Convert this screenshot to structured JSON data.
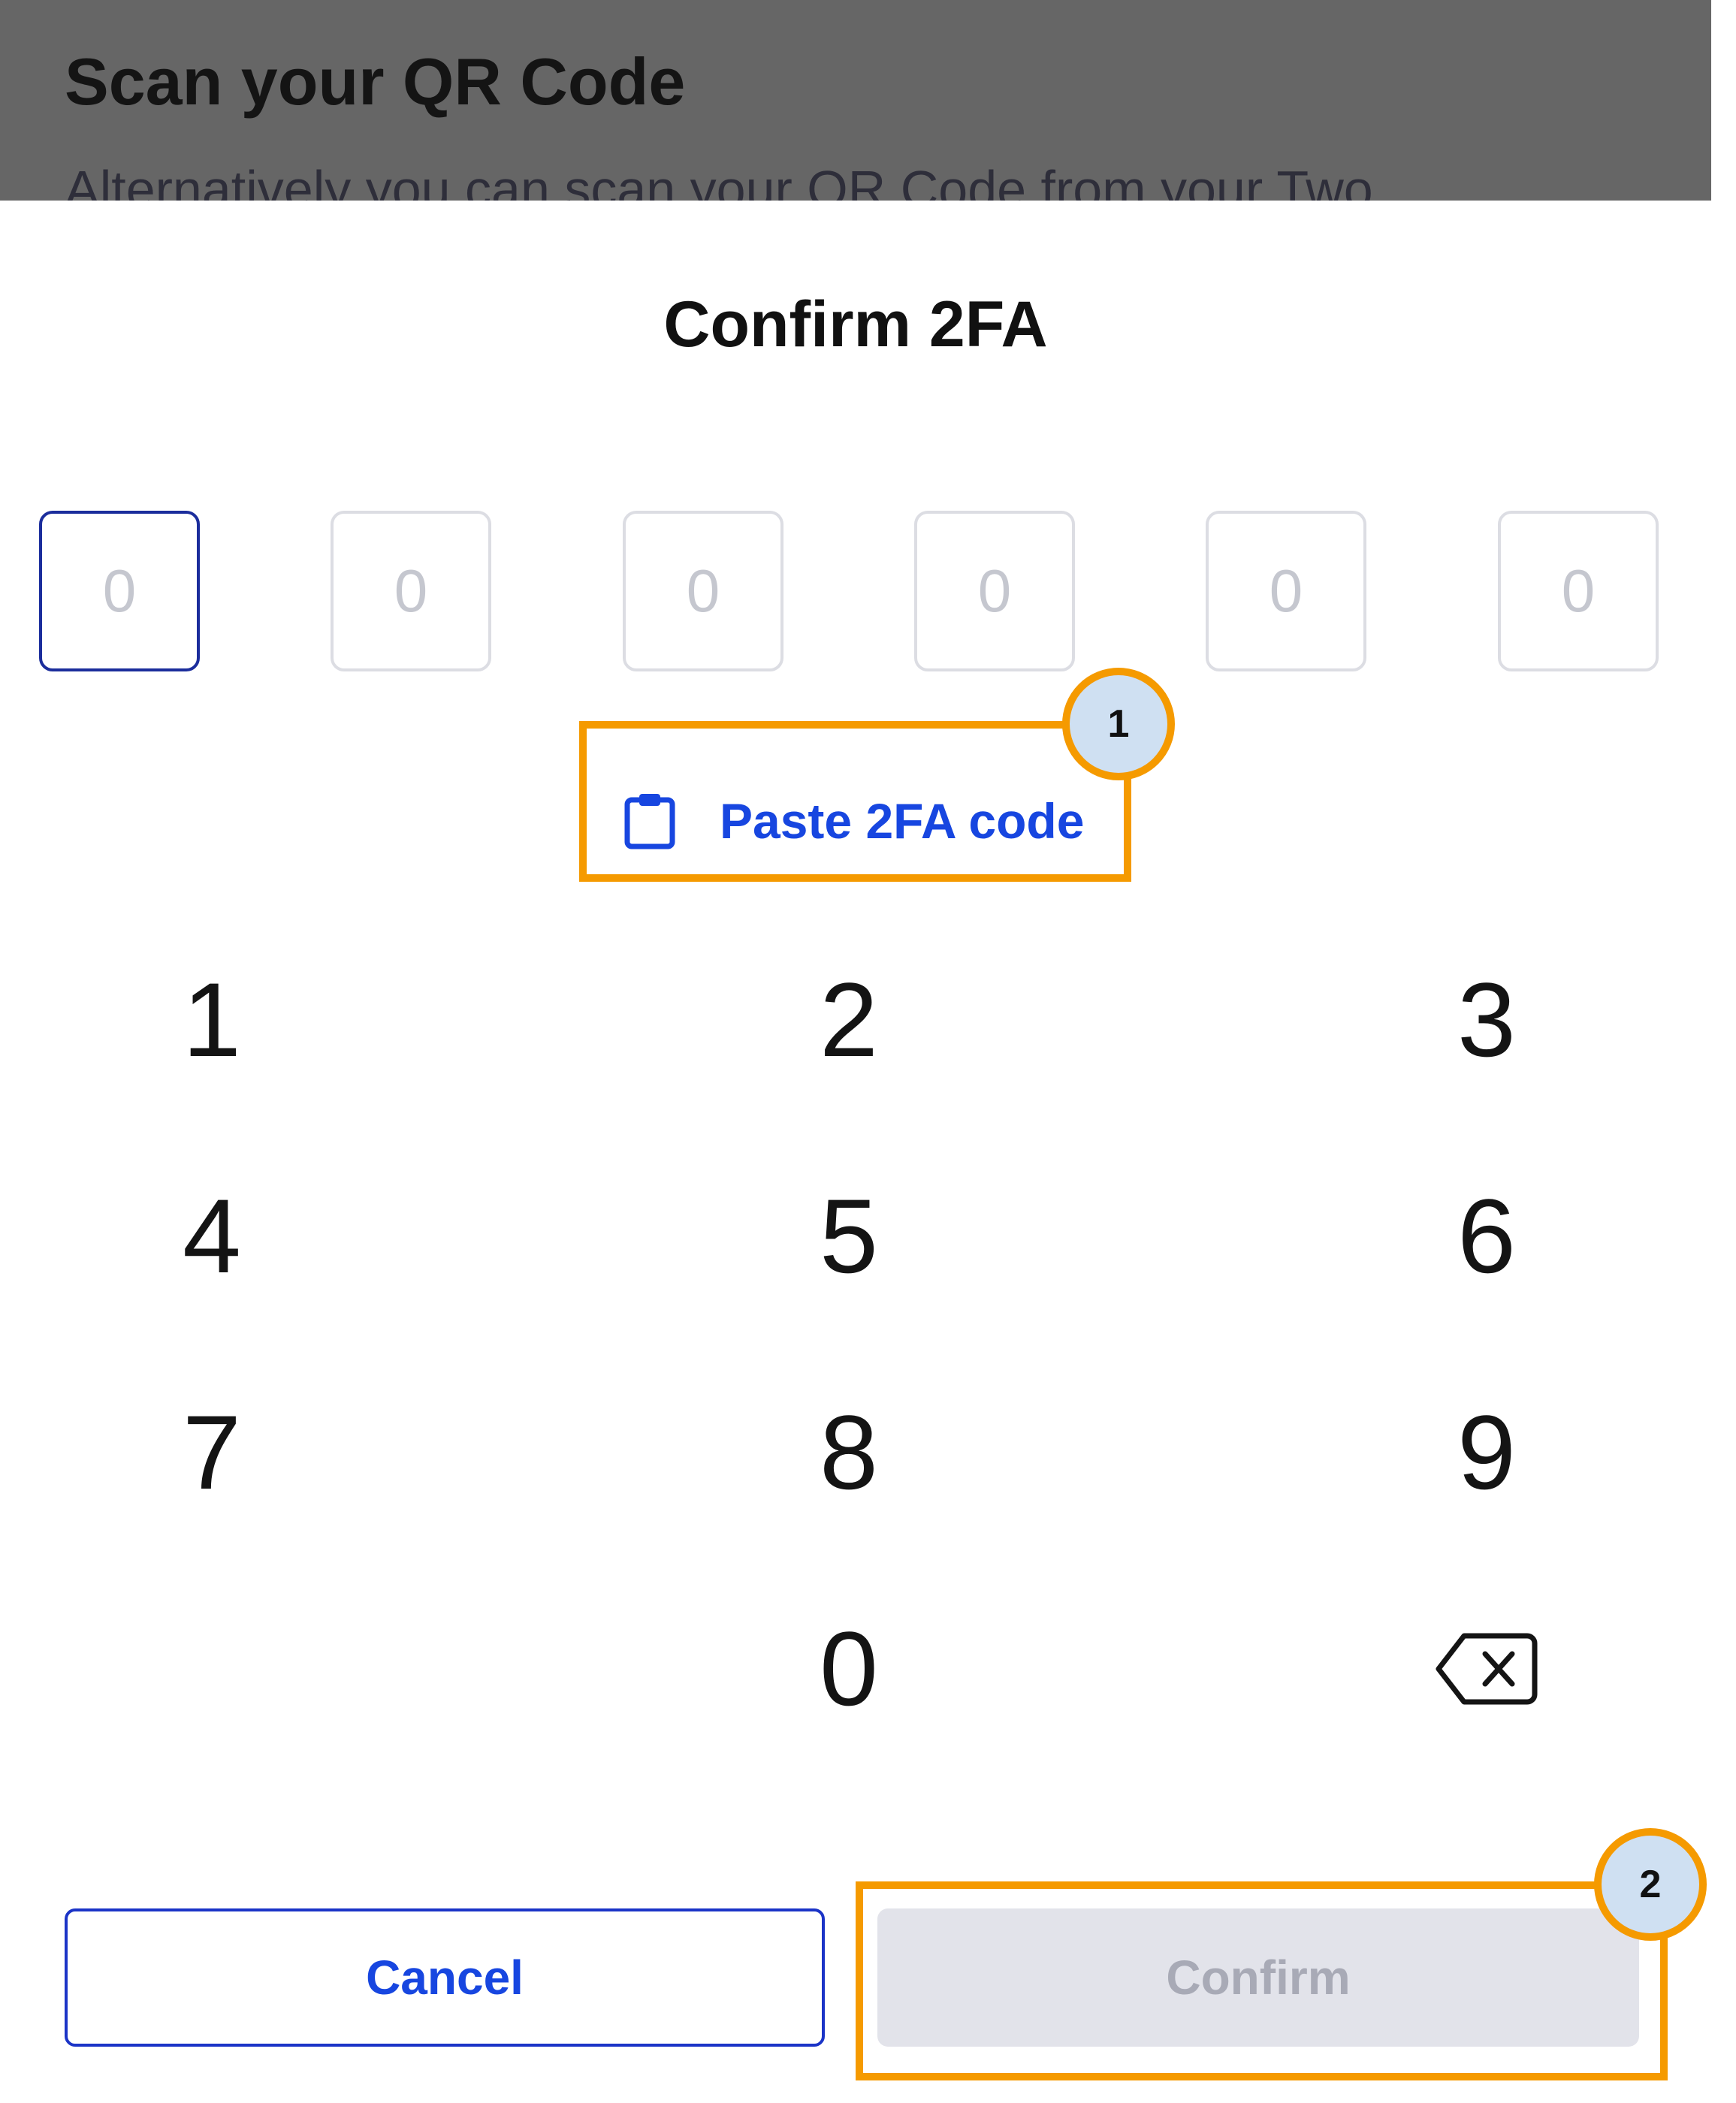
{
  "background_screen": {
    "title": "Scan your QR Code",
    "subtitle_partial": "Alternatively you can scan your QR Code from your Two"
  },
  "sheet": {
    "title": "Confirm 2FA",
    "otp_placeholders": [
      "0",
      "0",
      "0",
      "0",
      "0",
      "0"
    ],
    "paste_label": "Paste 2FA code",
    "paste_icon": "clipboard-icon",
    "keypad": [
      "1",
      "2",
      "3",
      "4",
      "5",
      "6",
      "7",
      "8",
      "9",
      "0"
    ],
    "backspace_icon": "backspace-icon",
    "cancel_label": "Cancel",
    "confirm_label": "Confirm"
  },
  "annotations": [
    {
      "label": "1"
    },
    {
      "label": "2"
    }
  ],
  "colors": {
    "accent_blue": "#1746e0",
    "focus_border": "#1b2d9c",
    "highlight_orange": "#f59a00",
    "badge_fill": "#cfe0f2",
    "disabled_bg": "#e2e3ea",
    "disabled_text": "#a8aab6",
    "overlay": "#666666"
  }
}
